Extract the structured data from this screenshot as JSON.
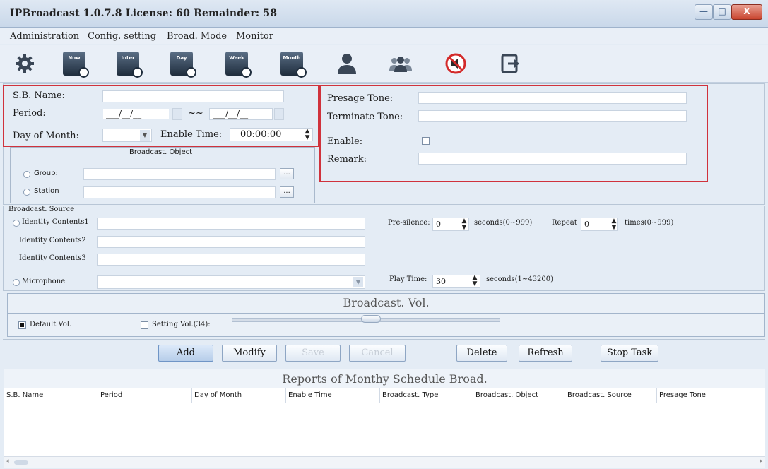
{
  "window": {
    "title": "IPBroadcast 1.0.7.8 License: 60 Remainder: 58",
    "minimize": "—",
    "maximize": "□",
    "close": "X"
  },
  "menu": [
    "Administration",
    "Config. setting",
    "Broad. Mode",
    "Monitor"
  ],
  "toolbar": {
    "icons": [
      "gear-icon",
      "schedule-now-icon",
      "schedule-interval-icon",
      "schedule-day-icon",
      "schedule-week-icon",
      "schedule-month-icon",
      "user-icon",
      "group-icon",
      "mute-icon",
      "exit-icon"
    ],
    "schedule_labels": [
      "Now",
      "Inter",
      "Day",
      "Week",
      "Month"
    ]
  },
  "form": {
    "sb_name_label": "S.B. Name:",
    "period_label": "Period:",
    "period_from": "___/__/__",
    "period_sep": "~~",
    "period_to": "___/__/__",
    "day_of_month_label": "Day of Month:",
    "enable_time_label": "Enable Time:",
    "enable_time_value": "00:00:00",
    "presage_tone_label": "Presage Tone:",
    "terminate_tone_label": "Terminate Tone:",
    "enable_label": "Enable:",
    "remark_label": "Remark:"
  },
  "broadcast_object": {
    "title": "Broadcast. Object",
    "group_label": "Group:",
    "station_label": "Station",
    "browse": "..."
  },
  "broadcast_source": {
    "title": "Broadcast. Source",
    "identity1": "Identity Contents1",
    "identity2": "Identity Contents2",
    "identity3": "Identity Contents3",
    "microphone": "Microphone",
    "pre_silence_label": "Pre-silence:",
    "pre_silence_value": "0",
    "pre_silence_unit": "seconds(0~999)",
    "repeat_label": "Repeat",
    "repeat_value": "0",
    "repeat_unit": "times(0~999)",
    "play_time_label": "Play Time:",
    "play_time_value": "30",
    "play_time_unit": "seconds(1~43200)"
  },
  "volume": {
    "title": "Broadcast. Vol.",
    "default_label": "Default Vol.",
    "default_checked": true,
    "setting_label": "Setting Vol.(34):",
    "setting_checked": false,
    "slider_value": 34
  },
  "buttons": {
    "add": "Add",
    "modify": "Modify",
    "save": "Save",
    "cancel": "Cancel",
    "delete": "Delete",
    "refresh": "Refresh",
    "stop_task": "Stop Task"
  },
  "report": {
    "title": "Reports of Monthy Schedule Broad.",
    "columns": [
      "S.B. Name",
      "Period",
      "Day of Month",
      "Enable Time",
      "Broadcast. Type",
      "Broadcast. Object",
      "Broadcast. Source",
      "Presage Tone"
    ],
    "rows": []
  },
  "colors": {
    "highlight_border": "#d0323c",
    "window_bg": "#e4ecf5"
  }
}
